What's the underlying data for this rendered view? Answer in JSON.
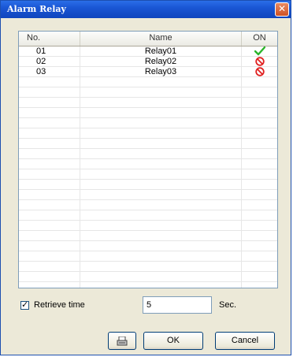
{
  "window": {
    "title": "Alarm Relay"
  },
  "table": {
    "columns": {
      "no": "No.",
      "name": "Name",
      "on": "ON"
    },
    "rows": [
      {
        "no": "01",
        "name": "Relay01",
        "state": "on"
      },
      {
        "no": "02",
        "name": "Relay02",
        "state": "off"
      },
      {
        "no": "03",
        "name": "Relay03",
        "state": "off"
      }
    ],
    "empty_row_count": 21
  },
  "retrieve": {
    "checked": true,
    "label": "Retrieve time",
    "value": "5",
    "unit": "Sec."
  },
  "buttons": {
    "print_icon": "printer-icon",
    "ok": "OK",
    "cancel": "Cancel"
  },
  "colors": {
    "titlebar": "#1a56d4",
    "on_check": "#2bb52b",
    "off_red": "#e02020"
  }
}
